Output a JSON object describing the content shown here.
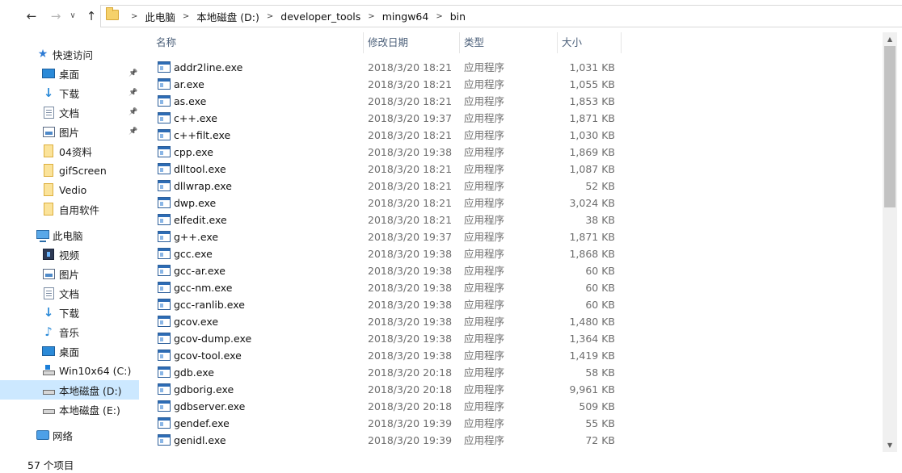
{
  "address": {
    "crumbs": [
      "此电脑",
      "本地磁盘 (D:)",
      "developer_tools",
      "mingw64",
      "bin"
    ]
  },
  "sidebar": {
    "quick_access": "快速访问",
    "quick_items": [
      {
        "label": "桌面",
        "icon": "desktop-icon"
      },
      {
        "label": "下载",
        "icon": "download-icon"
      },
      {
        "label": "文档",
        "icon": "document-icon"
      },
      {
        "label": "图片",
        "icon": "pictures-icon"
      },
      {
        "label": "04资料",
        "icon": "folder-icon"
      },
      {
        "label": "gifScreen",
        "icon": "folder-icon"
      },
      {
        "label": "Vedio",
        "icon": "folder-icon"
      },
      {
        "label": "自用软件",
        "icon": "folder-icon"
      }
    ],
    "this_pc": "此电脑",
    "pc_items": [
      {
        "label": "视频",
        "icon": "video-icon"
      },
      {
        "label": "图片",
        "icon": "pictures-icon"
      },
      {
        "label": "文档",
        "icon": "document-icon"
      },
      {
        "label": "下载",
        "icon": "download-icon"
      },
      {
        "label": "音乐",
        "icon": "music-icon"
      },
      {
        "label": "桌面",
        "icon": "desktop-icon"
      },
      {
        "label": "Win10x64 (C:)",
        "icon": "system-drive-icon"
      },
      {
        "label": "本地磁盘 (D:)",
        "icon": "drive-icon",
        "selected": true
      },
      {
        "label": "本地磁盘 (E:)",
        "icon": "drive-icon"
      }
    ],
    "network": "网络"
  },
  "columns": {
    "name": "名称",
    "date": "修改日期",
    "type": "类型",
    "size": "大小"
  },
  "files": [
    {
      "name": "addr2line.exe",
      "date": "2018/3/20 18:21",
      "type": "应用程序",
      "size": "1,031 KB"
    },
    {
      "name": "ar.exe",
      "date": "2018/3/20 18:21",
      "type": "应用程序",
      "size": "1,055 KB"
    },
    {
      "name": "as.exe",
      "date": "2018/3/20 18:21",
      "type": "应用程序",
      "size": "1,853 KB"
    },
    {
      "name": "c++.exe",
      "date": "2018/3/20 19:37",
      "type": "应用程序",
      "size": "1,871 KB"
    },
    {
      "name": "c++filt.exe",
      "date": "2018/3/20 18:21",
      "type": "应用程序",
      "size": "1,030 KB"
    },
    {
      "name": "cpp.exe",
      "date": "2018/3/20 19:38",
      "type": "应用程序",
      "size": "1,869 KB"
    },
    {
      "name": "dlltool.exe",
      "date": "2018/3/20 18:21",
      "type": "应用程序",
      "size": "1,087 KB"
    },
    {
      "name": "dllwrap.exe",
      "date": "2018/3/20 18:21",
      "type": "应用程序",
      "size": "52 KB"
    },
    {
      "name": "dwp.exe",
      "date": "2018/3/20 18:21",
      "type": "应用程序",
      "size": "3,024 KB"
    },
    {
      "name": "elfedit.exe",
      "date": "2018/3/20 18:21",
      "type": "应用程序",
      "size": "38 KB"
    },
    {
      "name": "g++.exe",
      "date": "2018/3/20 19:37",
      "type": "应用程序",
      "size": "1,871 KB"
    },
    {
      "name": "gcc.exe",
      "date": "2018/3/20 19:38",
      "type": "应用程序",
      "size": "1,868 KB"
    },
    {
      "name": "gcc-ar.exe",
      "date": "2018/3/20 19:38",
      "type": "应用程序",
      "size": "60 KB"
    },
    {
      "name": "gcc-nm.exe",
      "date": "2018/3/20 19:38",
      "type": "应用程序",
      "size": "60 KB"
    },
    {
      "name": "gcc-ranlib.exe",
      "date": "2018/3/20 19:38",
      "type": "应用程序",
      "size": "60 KB"
    },
    {
      "name": "gcov.exe",
      "date": "2018/3/20 19:38",
      "type": "应用程序",
      "size": "1,480 KB"
    },
    {
      "name": "gcov-dump.exe",
      "date": "2018/3/20 19:38",
      "type": "应用程序",
      "size": "1,364 KB"
    },
    {
      "name": "gcov-tool.exe",
      "date": "2018/3/20 19:38",
      "type": "应用程序",
      "size": "1,419 KB"
    },
    {
      "name": "gdb.exe",
      "date": "2018/3/20 20:18",
      "type": "应用程序",
      "size": "58 KB"
    },
    {
      "name": "gdborig.exe",
      "date": "2018/3/20 20:18",
      "type": "应用程序",
      "size": "9,961 KB"
    },
    {
      "name": "gdbserver.exe",
      "date": "2018/3/20 20:18",
      "type": "应用程序",
      "size": "509 KB"
    },
    {
      "name": "gendef.exe",
      "date": "2018/3/20 19:39",
      "type": "应用程序",
      "size": "55 KB"
    },
    {
      "name": "genidl.exe",
      "date": "2018/3/20 19:39",
      "type": "应用程序",
      "size": "72 KB"
    }
  ],
  "status": {
    "item_count": "57 个项目"
  },
  "colors": {
    "selected_bg": "#cce8ff",
    "header_text": "#4c607a",
    "muted_text": "#6d6d6d"
  }
}
